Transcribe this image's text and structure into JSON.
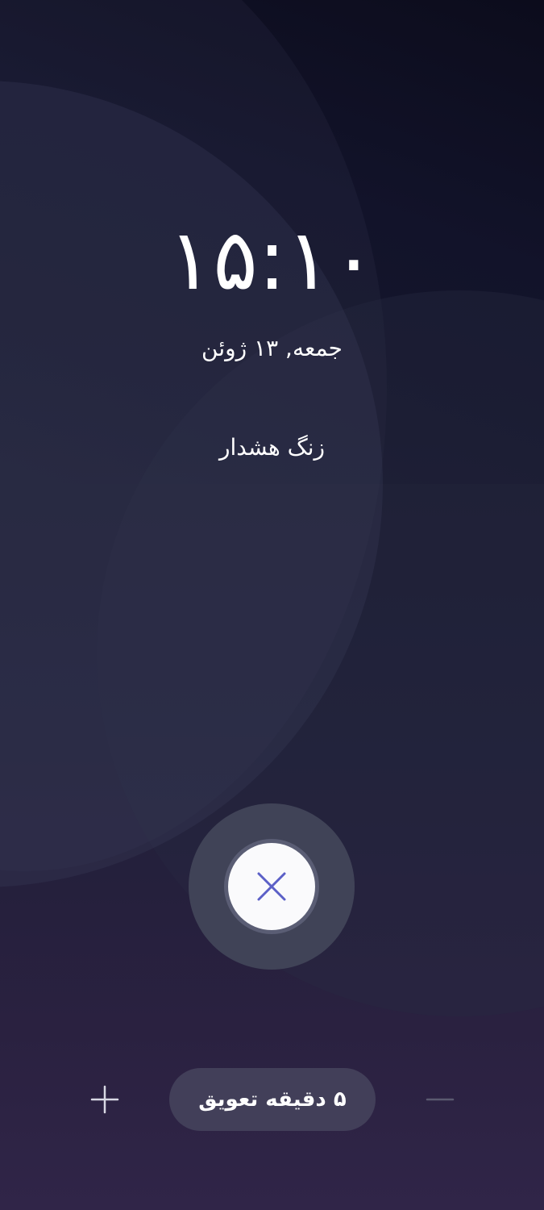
{
  "clock": {
    "time": "۱۵:۱۰",
    "date": "جمعه, ۱۳ ژوئن"
  },
  "alarm": {
    "label": "زنگ هشدار"
  },
  "dismiss": {
    "icon": "close-icon",
    "icon_color": "#5b5fc7"
  },
  "snooze": {
    "label": "۵ دقیقه تعویق",
    "increase_icon": "plus-icon",
    "decrease_icon": "minus-icon"
  }
}
